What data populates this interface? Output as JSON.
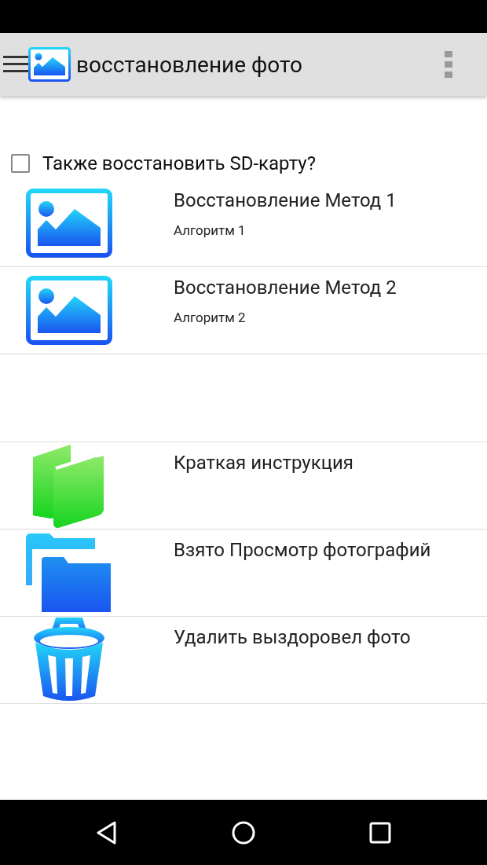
{
  "app_bar": {
    "title": "восстановление фото"
  },
  "sd_option": {
    "label": "Также восстановить SD-карту?",
    "checked": false
  },
  "methods": [
    {
      "kind": "image",
      "title": "Восстановление Метод 1",
      "subtitle": "Алгоритм 1"
    },
    {
      "kind": "image",
      "title": "Восстановление Метод 2",
      "subtitle": "Алгоритм 2"
    }
  ],
  "tools": [
    {
      "kind": "books",
      "title": "Краткая инструкция"
    },
    {
      "kind": "folders",
      "title": "Взято Просмотр фотографий"
    },
    {
      "kind": "trash",
      "title": "Удалить выздоровел фото"
    }
  ]
}
